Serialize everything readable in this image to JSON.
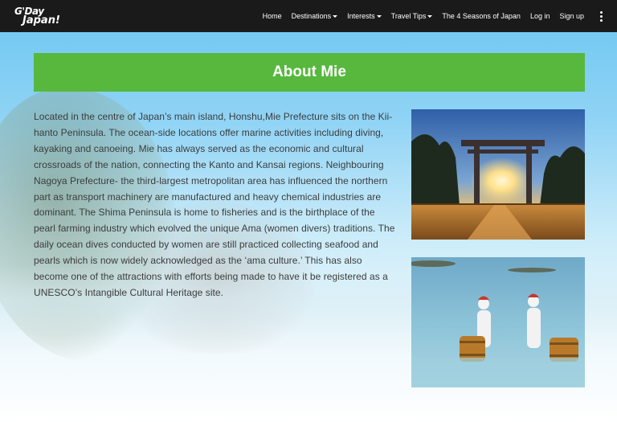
{
  "brand": {
    "logo_line1": "G'Day",
    "logo_line2": "Japan!"
  },
  "nav": {
    "items": [
      {
        "label": "Home",
        "dropdown": false
      },
      {
        "label": "Destinations",
        "dropdown": true
      },
      {
        "label": "Interests",
        "dropdown": true
      },
      {
        "label": "Travel Tips",
        "dropdown": true
      },
      {
        "label": "The 4 Seasons of Japan",
        "dropdown": false
      },
      {
        "label": "Log in",
        "dropdown": false
      },
      {
        "label": "Sign up",
        "dropdown": false
      }
    ],
    "more_icon": "kebab-menu-icon"
  },
  "main": {
    "heading": "About Mie",
    "paragraph": "Located in the centre of Japan’s main island, Honshu,Mie Prefecture sits on the Kii-hanto Peninsula. The ocean-side locations offer marine activities including diving, kayaking and canoeing. Mie has always served as the economic and cultural crossroads of the nation, connecting the Kanto and Kansai regions. Neighbouring Nagoya Prefecture- the third-largest metropolitan area has influenced the northern part as transport machinery are manufactured and heavy chemical industries are dominant. The Shima Peninsula is home to fisheries and is the birthplace of the pearl farming industry which evolved the unique Ama (women divers) traditions. The daily ocean dives conducted by women are still practiced collecting seafood and pearls which is now widely acknowledged as the ‘ama culture.’ This has also become one of the attractions with efforts being made to have it be registered as a UNESCO’s Intangible Cultural Heritage site."
  },
  "colors": {
    "navbar": "#1a1a1a",
    "heading_bg": "#57b83d",
    "text": "#3c3c3c"
  }
}
